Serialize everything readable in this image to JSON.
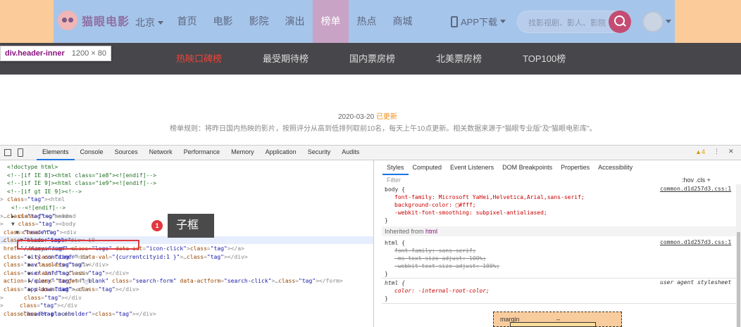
{
  "site": {
    "logo": "猫眼电影",
    "city": "北京",
    "nav": [
      "首页",
      "电影",
      "影院",
      "演出",
      "榜单",
      "热点",
      "商城"
    ],
    "app_download": "APP下载",
    "search_placeholder": "找影视剧、影人、影院"
  },
  "tooltip": {
    "name": "div.header-inner",
    "size": "1200 × 80"
  },
  "subnav": [
    "热映口碑榜",
    "最受期待榜",
    "国内票房榜",
    "北美票房榜",
    "TOP100榜"
  ],
  "date": "2020-03-20",
  "updated": "已更新",
  "rule": "榜单规则：将昨日国内热映的影片，按照评分从高到低排列取前10名，每天上午10点更新。相关数据来源于“猫眼专业版”及“猫眼电影库”。",
  "devtools": {
    "tabs": [
      "Elements",
      "Console",
      "Sources",
      "Network",
      "Performance",
      "Memory",
      "Application",
      "Security",
      "Audits"
    ],
    "warnings": "4",
    "dom_lines": [
      "<!doctype html>",
      "<!--[if IE 8]><html class=\"ie8\"><![endif]-->",
      "<!--[if IE 9]><html class=\"ie9\"><![endif]-->",
      "<!--[if gt IE 9]><!-->",
      "<html>",
      "<!--<![endif]-->",
      "<head>…</head>",
      "<body>",
      "<div class=\"header\">",
      "<div class=\"header-inner\"> == $0",
      "<a href=\"//maoyan.com\" class=\"logo\" data-act=\"icon-click\"></a>",
      "<div class=\"city-container\" data-val=\"{currentcityid:1 }\">…</div>",
      "<div class=\"nav\">…</div>",
      "<div class=\"user-info\">…</div>",
      "<form action=\"/query\" target=\"_blank\" class=\"search-form\" data-actform=\"search-click\">…</form>",
      "<div class=\"app-download\">…</div>",
      "</div>",
      "</div>",
      "<div class=\"header-placeholder\"></div>"
    ],
    "annotation_number": "1",
    "annotation_label": "子框",
    "styles_tabs": [
      "Styles",
      "Computed",
      "Event Listeners",
      "DOM Breakpoints",
      "Properties",
      "Accessibility"
    ],
    "filter": "Filter",
    "hov_cls": ":hov .cls",
    "body_rule": {
      "selector": "body {",
      "props": [
        "font-family: Microsoft YaHei,Helvetica,Arial,sans-serif;",
        "background-color: □#fff;",
        "-webkit-font-smoothing: subpixel-antialiased;"
      ],
      "source": "common.d1d257d3.css:1"
    },
    "inherited_from": "Inherited from",
    "inherited_tag": "html",
    "html_rule": {
      "selector": "html {",
      "props": [
        "font-family: sans-serif;",
        "-ms-text-size-adjust: 100%;",
        "-webkit-text-size-adjust: 100%;"
      ],
      "source": "common.d1d257d3.css:1"
    },
    "ua_rule": {
      "selector": "html {",
      "props": [
        "color: -internal-root-color;"
      ],
      "source": "user agent stylesheet"
    },
    "close_brace": "}",
    "box_margin": "margin",
    "box_dash": "–"
  }
}
